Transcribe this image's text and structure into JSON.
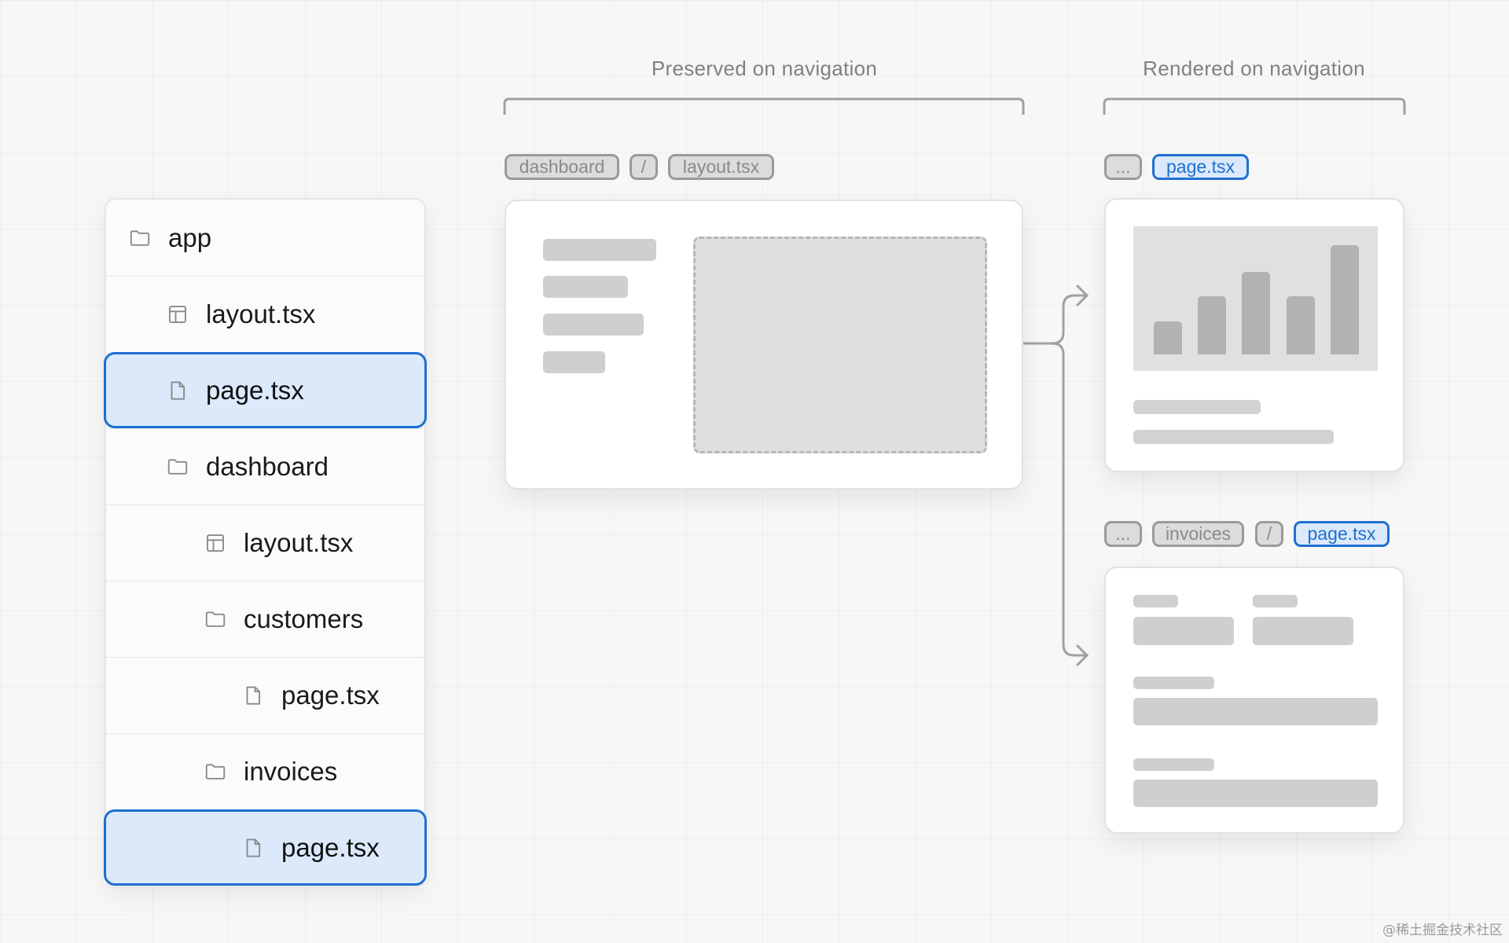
{
  "tree": {
    "items": [
      {
        "label": "app",
        "icon": "folder-icon",
        "depth": 0,
        "selected": false
      },
      {
        "label": "layout.tsx",
        "icon": "layout-icon",
        "depth": 1,
        "selected": false
      },
      {
        "label": "page.tsx",
        "icon": "file-icon",
        "depth": 1,
        "selected": true
      },
      {
        "label": "dashboard",
        "icon": "folder-icon",
        "depth": 1,
        "selected": false
      },
      {
        "label": "layout.tsx",
        "icon": "layout-icon",
        "depth": 2,
        "selected": false
      },
      {
        "label": "customers",
        "icon": "folder-icon",
        "depth": 2,
        "selected": false
      },
      {
        "label": "page.tsx",
        "icon": "file-icon",
        "depth": 3,
        "selected": false
      },
      {
        "label": "invoices",
        "icon": "folder-icon",
        "depth": 2,
        "selected": false
      },
      {
        "label": "page.tsx",
        "icon": "file-icon",
        "depth": 3,
        "selected": true
      }
    ]
  },
  "preserved": {
    "heading": "Preserved on navigation",
    "breadcrumb": [
      "dashboard",
      "/",
      "layout.tsx"
    ]
  },
  "rendered": {
    "heading": "Rendered on navigation",
    "top_breadcrumb": [
      "...",
      "page.tsx"
    ],
    "bottom_breadcrumb": [
      "...",
      "invoices",
      "/",
      "page.tsx"
    ]
  },
  "colors": {
    "accent": "#1f6fd1",
    "selected_bg": "#dbe9fb",
    "placeholder": "#cfcfcf",
    "connector": "#a0a0a0"
  },
  "watermark": "@稀土掘金技术社区"
}
